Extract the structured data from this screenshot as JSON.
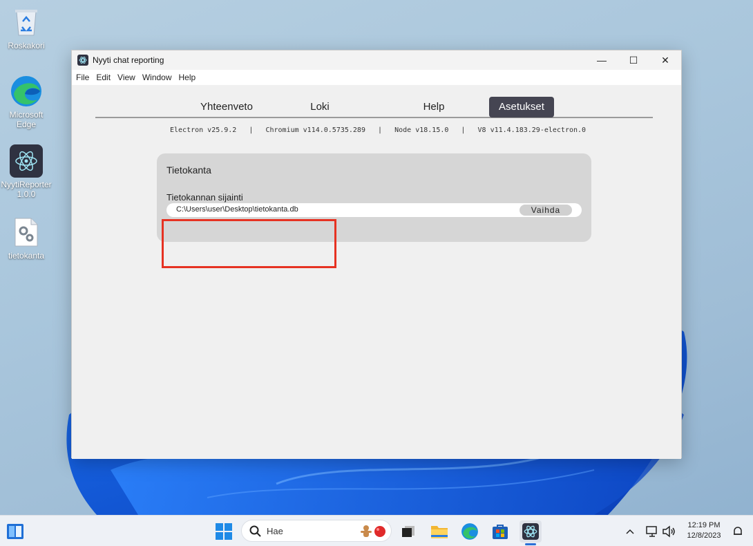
{
  "desktop": {
    "icons": [
      {
        "label": "Roskakori"
      },
      {
        "label": "Microsoft Edge"
      },
      {
        "label": "NyytiReporter 1.0.0"
      },
      {
        "label": "tietokanta"
      }
    ]
  },
  "window": {
    "title": "Nyyti chat reporting",
    "controls": {
      "minimize": "—",
      "maximize": "☐",
      "close": "✕"
    },
    "menu": [
      "File",
      "Edit",
      "View",
      "Window",
      "Help"
    ]
  },
  "tabs": [
    {
      "label": "Yhteenveto",
      "active": false
    },
    {
      "label": "Loki",
      "active": false
    },
    {
      "label": "Help",
      "active": false
    },
    {
      "label": "Asetukset",
      "active": true
    }
  ],
  "versions": "Electron v25.9.2   |   Chromium v114.0.5735.289   |   Node v18.15.0   |   V8 v11.4.183.29-electron.0",
  "settings": {
    "section_title": "Tietokanta",
    "field_label": "Tietokannan sijainti",
    "path_value": "C:\\Users\\user\\Desktop\\tietokanta.db",
    "change_button": "Vaihda"
  },
  "taskbar": {
    "search_placeholder": "Hae",
    "time": "12:19 PM",
    "date": "12/8/2023"
  },
  "colors": {
    "active_tab": "#454552",
    "highlight_box": "#e63222",
    "panel_bg": "#d6d6d6"
  }
}
